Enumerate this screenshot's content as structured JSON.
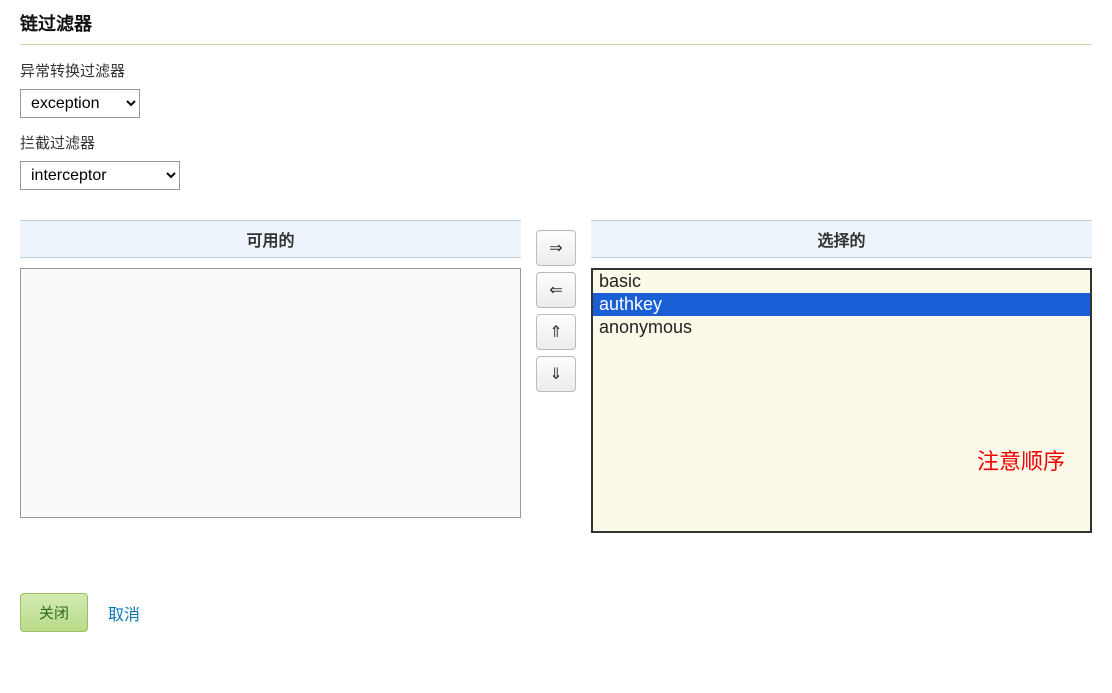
{
  "section_title": "链过滤器",
  "exception_filter": {
    "label": "异常转换过滤器",
    "value": "exception"
  },
  "interceptor_filter": {
    "label": "拦截过滤器",
    "value": "interceptor"
  },
  "dual_list": {
    "available_header": "可用的",
    "selected_header": "选择的",
    "available_items": [],
    "selected_items": [
      {
        "label": "basic",
        "selected": false
      },
      {
        "label": "authkey",
        "selected": true
      },
      {
        "label": "anonymous",
        "selected": false
      }
    ],
    "annotation": "注意顺序"
  },
  "transfer_buttons": {
    "move_right": "⇒",
    "move_left": "⇐",
    "move_up": "⇑",
    "move_down": "⇓"
  },
  "buttons": {
    "close": "关闭",
    "cancel": "取消"
  }
}
